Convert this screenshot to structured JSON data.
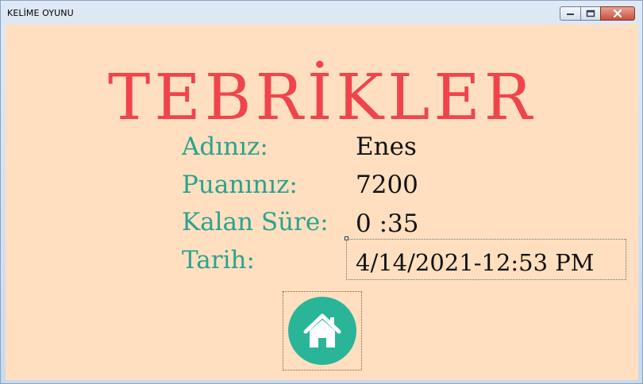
{
  "window": {
    "title": "KELİME OYUNU"
  },
  "main": {
    "heading": "TEBRİKLER",
    "fields": [
      {
        "label": "Adınız:",
        "value": "Enes"
      },
      {
        "label": "Puanınız:",
        "value": "7200"
      },
      {
        "label": "Kalan Süre:",
        "value": "0  :35"
      },
      {
        "label": "Tarih:",
        "value": "4/14/2021-12:53 PM"
      }
    ],
    "home_button_icon": "home-icon"
  },
  "colors": {
    "background": "#ffdfbf",
    "heading": "#f0444d",
    "label": "#2aa38f",
    "home_button": "#2bb598"
  }
}
